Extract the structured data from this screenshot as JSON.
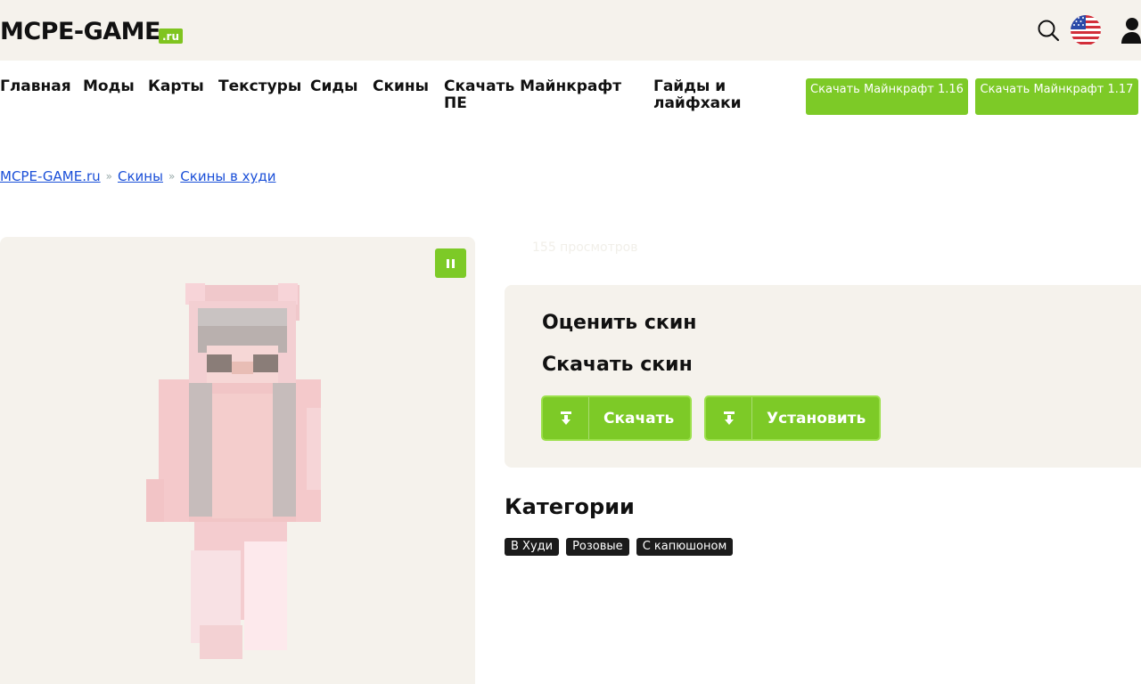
{
  "header": {
    "logo_text": "MCPE-GAME",
    "logo_suffix": ".ru",
    "accent_color": "#7dca27"
  },
  "nav": {
    "items": [
      "Главная",
      "Моды",
      "Карты",
      "Текстуры",
      "Сиды",
      "Скины",
      "Скачать Майнкрафт ПЕ",
      "Гайды и лайфхаки"
    ],
    "buttons": [
      "Скачать Майнкрафт 1.16",
      "Скачать Майнкрафт 1.17"
    ]
  },
  "breadcrumb": {
    "items": [
      "MCPE-GAME.ru",
      "Скины",
      "Скины в худи"
    ],
    "separator": "»"
  },
  "skin": {
    "views": "155 просмотров"
  },
  "card": {
    "rate_title": "Оценить скин",
    "download_title": "Скачать скин",
    "download_label": "Скачать",
    "install_label": "Установить"
  },
  "categories": {
    "title": "Категории",
    "tags": [
      "В Худи",
      "Розовые",
      "С капюшоном"
    ]
  },
  "icons": {
    "search": "search-icon",
    "flag": "us-flag-icon",
    "user": "user-icon",
    "pause": "pause-icon",
    "download": "download-icon"
  }
}
